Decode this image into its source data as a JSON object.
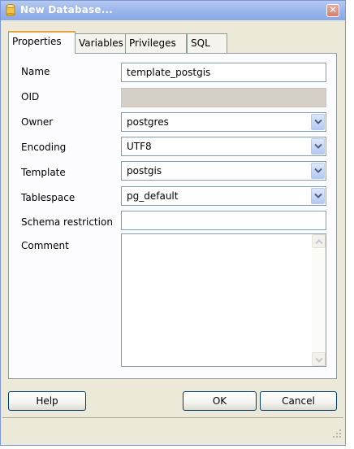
{
  "window": {
    "title": "New Database..."
  },
  "tabs": [
    {
      "label": "Properties",
      "active": true
    },
    {
      "label": "Variables",
      "active": false
    },
    {
      "label": "Privileges",
      "active": false
    },
    {
      "label": "SQL",
      "active": false
    }
  ],
  "form": {
    "name": {
      "label": "Name",
      "value": "template_postgis"
    },
    "oid": {
      "label": "OID",
      "value": ""
    },
    "owner": {
      "label": "Owner",
      "value": "postgres"
    },
    "encoding": {
      "label": "Encoding",
      "value": "UTF8"
    },
    "template": {
      "label": "Template",
      "value": "postgis"
    },
    "tablespace": {
      "label": "Tablespace",
      "value": "pg_default"
    },
    "schema_restriction": {
      "label": "Schema restriction",
      "value": ""
    },
    "comment": {
      "label": "Comment",
      "value": ""
    }
  },
  "buttons": {
    "help": "Help",
    "ok": "OK",
    "cancel": "Cancel"
  },
  "icons": {
    "title": "database-icon",
    "close": "close-icon",
    "dropdown": "chevron-down-icon"
  },
  "colors": {
    "titlebar": "#9db7ec",
    "window_bg": "#ece9d8",
    "active_tab_accent": "#e6a23c",
    "field_border": "#7f9db9"
  }
}
